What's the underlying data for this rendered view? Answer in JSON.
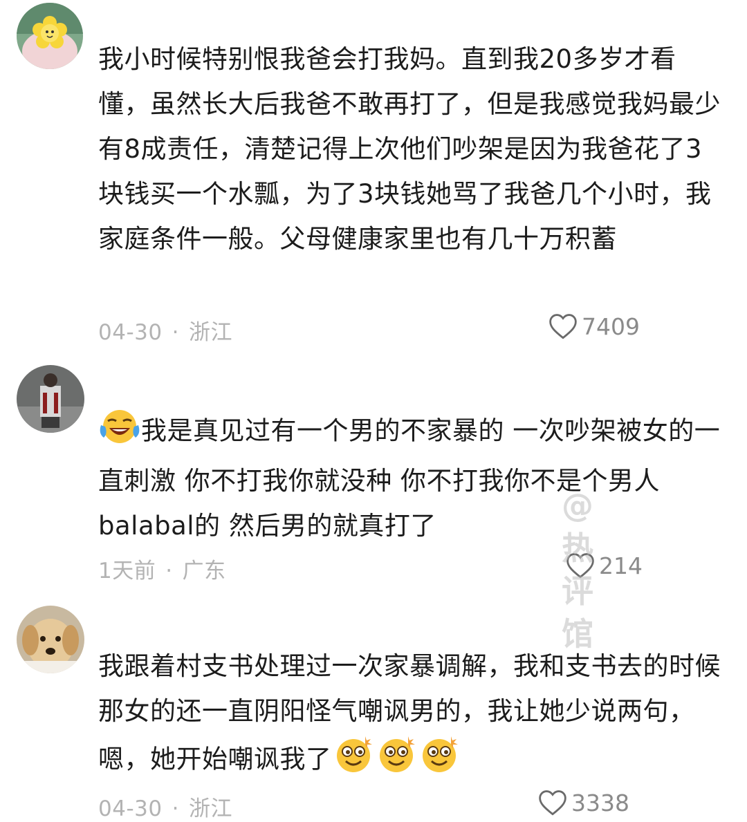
{
  "comments": [
    {
      "text": "我小时候特别恨我爸会打我妈。直到我20多岁才看懂，虽然长大后我爸不敢再打了，但是我感觉我妈最少有8成责任，清楚记得上次他们吵架是因为我爸花了3块钱买一个水瓢，为了3块钱她骂了我爸几个小时，我家庭条件一般。父母健康家里也有几十万积蓄",
      "date": "04-30",
      "location": "浙江",
      "likes": "7409"
    },
    {
      "text": "我是真见过有一个男的不家暴的 一次吵架被女的一直刺激 你不打我你就没种 你不打我你不是个男人balabal的 然后男的就真打了",
      "date": "1天前",
      "location": "广东",
      "likes": "214"
    },
    {
      "text": "我跟着村支书处理过一次家暴调解，我和支书去的时候那女的还一直阴阳怪气嘲讽男的，我让她少说两句，嗯，她开始嘲讽我了",
      "date": "04-30",
      "location": "浙江",
      "likes": "3338"
    }
  ],
  "separator": "·",
  "watermark": [
    "@",
    "热",
    "评",
    "馆"
  ],
  "icons": {
    "like": "heart-outline-icon",
    "emoji_laugh": "laughing-crying-emoji-icon",
    "emoji_dizzy": "dizzy-smile-emoji-icon"
  },
  "colors": {
    "text": "#1c1c1c",
    "meta": "#b3b3b3",
    "likes": "#8a8a8a"
  }
}
